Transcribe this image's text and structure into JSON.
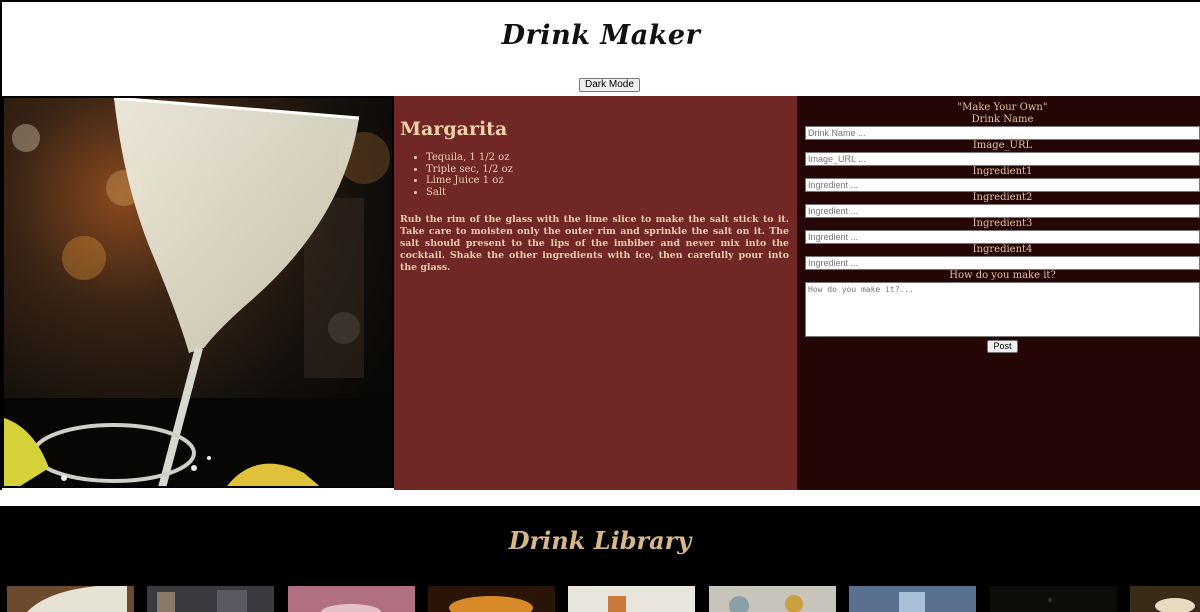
{
  "header": {
    "title": "Drink Maker",
    "dark_mode_label": "Dark Mode"
  },
  "recipe": {
    "name": "Margarita",
    "ingredients": [
      "Tequila, 1 1/2 oz",
      "Triple sec, 1/2 oz",
      "Lime Juice 1 oz",
      "Salt"
    ],
    "instructions": "Rub the rim of the glass with the lime slice to make the salt stick to it. Take care to moisten only the outer rim and sprinkle the salt on it. The salt should present to the lips of the imbiber and never mix into the cocktail. Shake the other ingredients with ice, then carefully pour into the glass."
  },
  "form": {
    "heading": "\"Make Your Own\"",
    "fields": [
      {
        "label": "Drink Name",
        "placeholder": "Drink Name ..."
      },
      {
        "label": "Image_URL",
        "placeholder": "Image_URL ..."
      },
      {
        "label": "Ingredient1",
        "placeholder": "Ingredient ..."
      },
      {
        "label": "Ingredient2",
        "placeholder": "Ingredient ..."
      },
      {
        "label": "Ingredient3",
        "placeholder": "Ingredient ..."
      },
      {
        "label": "Ingredient4",
        "placeholder": "Ingredient ..."
      }
    ],
    "method_label": "How do you make it?",
    "method_placeholder": "How do you make it?...",
    "post_label": "Post"
  },
  "library": {
    "title": "Drink Library",
    "thumbnails": [
      {
        "name": "margarita-thumbnail",
        "color": "#6b4a2e"
      },
      {
        "name": "bar-thumbnail",
        "color": "#3a3a40"
      },
      {
        "name": "pink-drink-thumbnail",
        "color": "#b07080"
      },
      {
        "name": "whiskey-sour-thumbnail",
        "color": "#7a3a18"
      },
      {
        "name": "old-fashioned-thumbnail",
        "color": "#e9e4dc"
      },
      {
        "name": "citrus-thumbnail",
        "color": "#c8c4bc"
      },
      {
        "name": "blue-drink-thumbnail",
        "color": "#5a7090"
      },
      {
        "name": "dark-drink-thumbnail",
        "color": "#0e0c08"
      },
      {
        "name": "tropical-thumbnail",
        "color": "#3a2a18"
      }
    ]
  },
  "colors": {
    "recipe_bg": "#722727",
    "form_bg": "#250606",
    "accent_text": "#e6c49b",
    "library_bg": "#000000"
  }
}
